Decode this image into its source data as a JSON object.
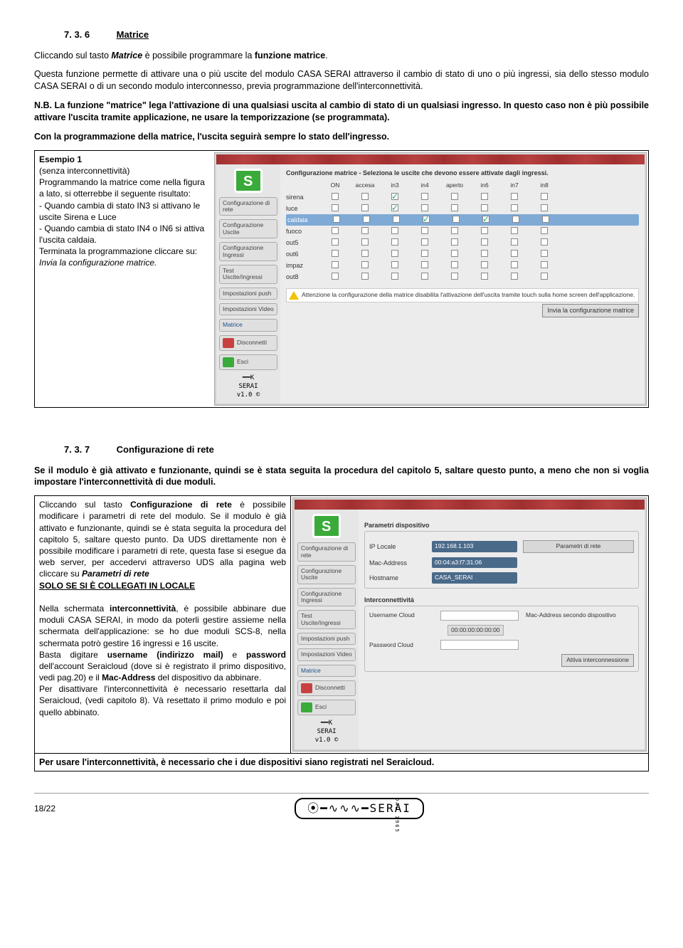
{
  "section1": {
    "num": "7. 3. 6",
    "title": "Matrice",
    "p1_a": "Cliccando sul tasto ",
    "p1_b": "Matrice",
    "p1_c": " è possibile programmare la ",
    "p1_d": "funzione matrice",
    "p1_e": ".",
    "p2": "Questa funzione permette di attivare una o più uscite del modulo CASA SERAI attraverso il cambio di stato di uno o più ingressi, sia dello stesso modulo CASA SERAI o di un secondo modulo interconnesso, previa programmazione dell'interconnettività.",
    "p3": "N.B. La funzione \"matrice\" lega l'attivazione di una qualsiasi uscita al cambio di stato di un qualsiasi ingresso. In questo caso non è più possibile attivare l'uscita tramite applicazione, ne usare la temporizzazione (se programmata).",
    "p4": "Con la programmazione della matrice, l'uscita seguirà sempre lo stato dell'ingresso."
  },
  "example1": {
    "title": "Esempio 1",
    "l1": "(senza interconnettività)",
    "l2": "Programmando la matrice come nella figura a lato, si otterrebbe il seguente risultato:",
    "l3": "- Quando cambia di stato IN3 si attivano le uscite Sirena e Luce",
    "l4": "- Quando cambia di stato IN4 o IN6 si attiva l'uscita caldaia.",
    "l5": "Terminata la programmazione cliccare su:",
    "l6": "Invia la configurazione matrice."
  },
  "shot1": {
    "head": "Configurazione matrice - Seleziona le uscite che devono essere attivate dagli ingressi.",
    "cols": [
      "ON",
      "accesa",
      "in3",
      "in4",
      "aperto",
      "in6",
      "in7",
      "in8"
    ],
    "rows": [
      {
        "name": "sirena",
        "checks": [
          false,
          false,
          true,
          false,
          false,
          false,
          false,
          false
        ]
      },
      {
        "name": "luce",
        "checks": [
          false,
          false,
          true,
          false,
          false,
          false,
          false,
          false
        ]
      },
      {
        "name": "caldaia",
        "checks": [
          false,
          false,
          false,
          true,
          false,
          true,
          false,
          false
        ],
        "sel": true
      },
      {
        "name": "fuoco",
        "checks": [
          false,
          false,
          false,
          false,
          false,
          false,
          false,
          false
        ]
      },
      {
        "name": "out5",
        "checks": [
          false,
          false,
          false,
          false,
          false,
          false,
          false,
          false
        ]
      },
      {
        "name": "out6",
        "checks": [
          false,
          false,
          false,
          false,
          false,
          false,
          false,
          false
        ]
      },
      {
        "name": "impaz",
        "checks": [
          false,
          false,
          false,
          false,
          false,
          false,
          false,
          false
        ]
      },
      {
        "name": "out8",
        "checks": [
          false,
          false,
          false,
          false,
          false,
          false,
          false,
          false
        ]
      }
    ],
    "side": [
      "Configurazione di rete",
      "Configurazione Uscite",
      "Configurazione Ingressi",
      "Test Uscite/Ingressi",
      "Impostazioni push",
      "Impostazioni Video"
    ],
    "matrice": "Matrice",
    "disc": "Disconnetti",
    "esci": "Esci",
    "brand": "SERAI",
    "ver": "v1.0 ©",
    "warn": "Attenzione la configurazione della matrice disabilita l'attivazione dell'uscita tramite touch sulla home screen dell'applicazione.",
    "submit": "Invia la configurazione matrice"
  },
  "section2": {
    "num": "7. 3. 7",
    "title": "Configurazione di rete",
    "p1": "Se il modulo è già attivato e funzionante, quindi se è stata seguita la procedura del capitolo 5, saltare questo punto, a meno che non si voglia impostare l'interconnettività di due moduli."
  },
  "table2": {
    "l1a": "Cliccando sul tasto ",
    "l1b": "Configurazione di rete",
    "l1c": " è possibile modificare i parametri di rete del modulo.",
    "l2": "Se il modulo è già attivato e funzionante, quindi se è stata seguita la procedura del capitolo 5, saltare questo punto. Da UDS direttamente non è possibile modificare i parametri di rete, questa fase si esegue da web server, per accedervi attraverso UDS alla pagina web cliccare su ",
    "l2b": "Parametri di rete",
    "l3": "SOLO SE SI È COLLEGATI IN LOCALE",
    "l4a": "Nella schermata ",
    "l4b": "interconnettività",
    "l4c": ", è possibile abbinare due moduli CASA SERAI, in modo da poterli gestire assieme nella schermata dell'applicazione: se ho due moduli SCS-8, nella schermata potrò gestire 16 ingressi e 16 uscite.",
    "l5a": "Basta digitare ",
    "l5b": "username (indirizzo mail)",
    "l5c": " e ",
    "l5d": "password",
    "l5e": " dell'account Seraicloud (dove si è registrato il primo dispositivo, vedi pag.20) e il ",
    "l5f": "Mac-Address",
    "l5g": " del dispositivo da abbinare.",
    "l6": "Per disattivare l'interconnettività è necessario resettarla dal Seraicloud, (vedi capitolo 8). Và resettato il primo modulo e poi quello abbinato.",
    "bottom": "Per usare l'interconnettività, è necessario che i due dispositivi siano registrati nel Seraicloud."
  },
  "shot2": {
    "sec1": "Parametri dispositivo",
    "ip_l": "IP Locale",
    "ip_v": "192.168.1.103",
    "ip_btn": "Parametri di rete",
    "mac_l": "Mac-Address",
    "mac_v": "00:04:a3:f7:31:06",
    "host_l": "Hostname",
    "host_v": "CASA_SERAI",
    "sec2": "Interconnettività",
    "u_l": "Username Cloud",
    "mac2_l": "Mac-Address secondo dispositivo",
    "mac2_v": "00:00:00:00:00:00",
    "p_l": "Password Cloud",
    "act": "Attiva interconnessione"
  },
  "footer": {
    "page": "18/22",
    "brand": "SERAI",
    "dal": "DAL 1965"
  }
}
